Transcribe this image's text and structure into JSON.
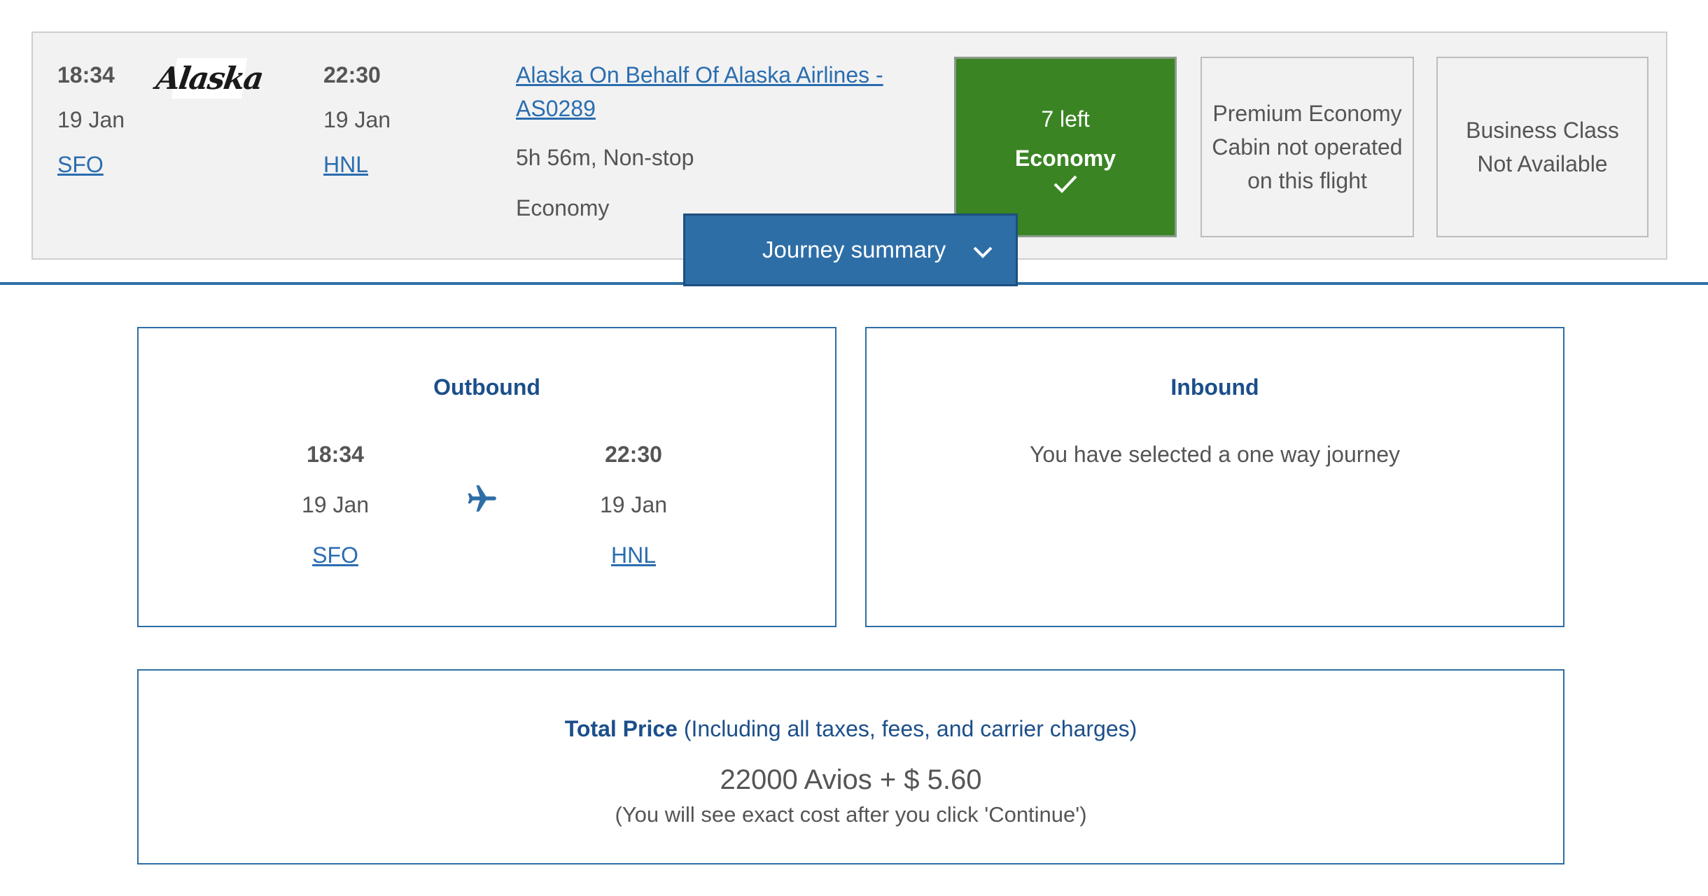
{
  "flight": {
    "depart_time": "18:34",
    "depart_date": "19 Jan",
    "depart_airport": "SFO",
    "airline_logo_text": "Alaska",
    "arrive_time": "22:30",
    "arrive_date": "19 Jan",
    "arrive_airport": "HNL",
    "carrier_link_line1": "Alaska On Behalf Of Alaska Airlines -",
    "carrier_link_line2": "AS0289",
    "duration": "5h 56m, Non-stop",
    "cabin": "Economy"
  },
  "fares": {
    "economy": {
      "seats_left": "7 left",
      "label": "Economy",
      "selected": true,
      "color": "#3a8424"
    },
    "premium": {
      "line1": "Premium Economy",
      "line2": "Cabin not operated",
      "line3": "on this flight"
    },
    "business": {
      "line1": "Business Class",
      "line2": "Not Available"
    }
  },
  "journey_summary": {
    "label": "Journey summary",
    "icon": "chevron-down-icon",
    "color": "#2e6ea6"
  },
  "outbound": {
    "title": "Outbound",
    "depart_time": "18:34",
    "depart_date": "19 Jan",
    "depart_airport": "SFO",
    "icon": "airplane-icon",
    "arrive_time": "22:30",
    "arrive_date": "19 Jan",
    "arrive_airport": "HNL"
  },
  "inbound": {
    "title": "Inbound",
    "message": "You have selected a one way journey"
  },
  "total": {
    "label": "Total Price",
    "qualifier": "(Including all taxes, fees, and carrier charges)",
    "value": "22000 Avios + $ 5.60",
    "note": "(You will see exact cost after you click 'Continue')"
  }
}
